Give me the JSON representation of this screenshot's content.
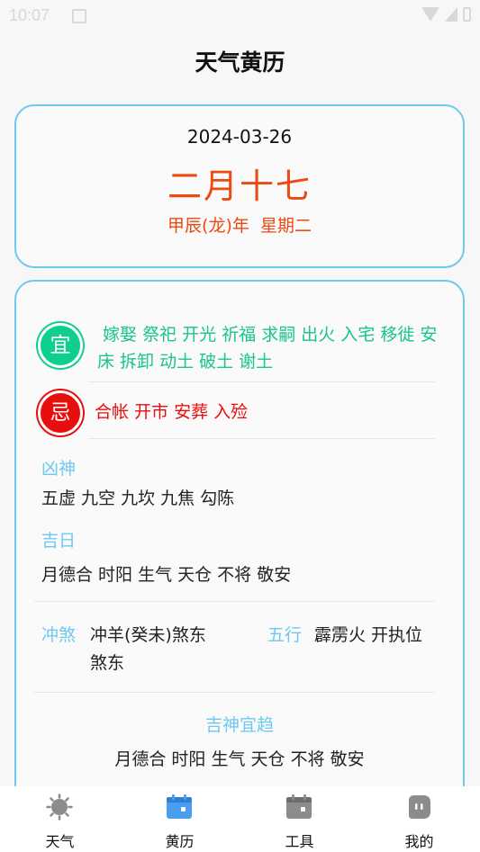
{
  "status_bar": {
    "time": "10:07"
  },
  "header": {
    "title": "天气黄历"
  },
  "date_card": {
    "solar_date": "2024-03-26",
    "lunar_date": "二月十七",
    "ganzhi_weekday": "甲辰(龙)年  星期二"
  },
  "almanac": {
    "yi": {
      "badge": "宜",
      "text": " 嫁娶 祭祀 开光 祈福 求嗣 出火 入宅 移徙 安床 拆卸 动土 破土 谢土"
    },
    "ji": {
      "badge": "忌",
      "text": "合帐 开市 安葬 入殓"
    },
    "xiongshen": {
      "label": "凶神",
      "text": "五虚 九空 九坎 九焦 勾陈"
    },
    "jiri": {
      "label": "吉日",
      "text": "月德合 时阳 生气 天仓 不将 敬安"
    },
    "chongsha": {
      "label": "冲煞",
      "line1": "冲羊(癸未)煞东",
      "line2": "煞东"
    },
    "wuxing": {
      "label": "五行",
      "text": "霹雳火 开执位"
    },
    "jishen": {
      "label": "吉神宜趋",
      "text": "月德合 时阳 生气 天仓 不将 敬安"
    }
  },
  "tabs": [
    {
      "label": "天气",
      "icon": "sun-icon"
    },
    {
      "label": "黄历",
      "icon": "calendar-icon",
      "active": true
    },
    {
      "label": "工具",
      "icon": "toolbox-icon"
    },
    {
      "label": "我的",
      "icon": "profile-icon"
    }
  ],
  "colors": {
    "accent_blue": "#6ec8f0",
    "lunar_orange": "#ec4a12",
    "yi_green": "#19c48f",
    "ji_red": "#e80e0e",
    "tab_active": "#4a9ef0",
    "tab_inactive": "#8c8c8c"
  }
}
